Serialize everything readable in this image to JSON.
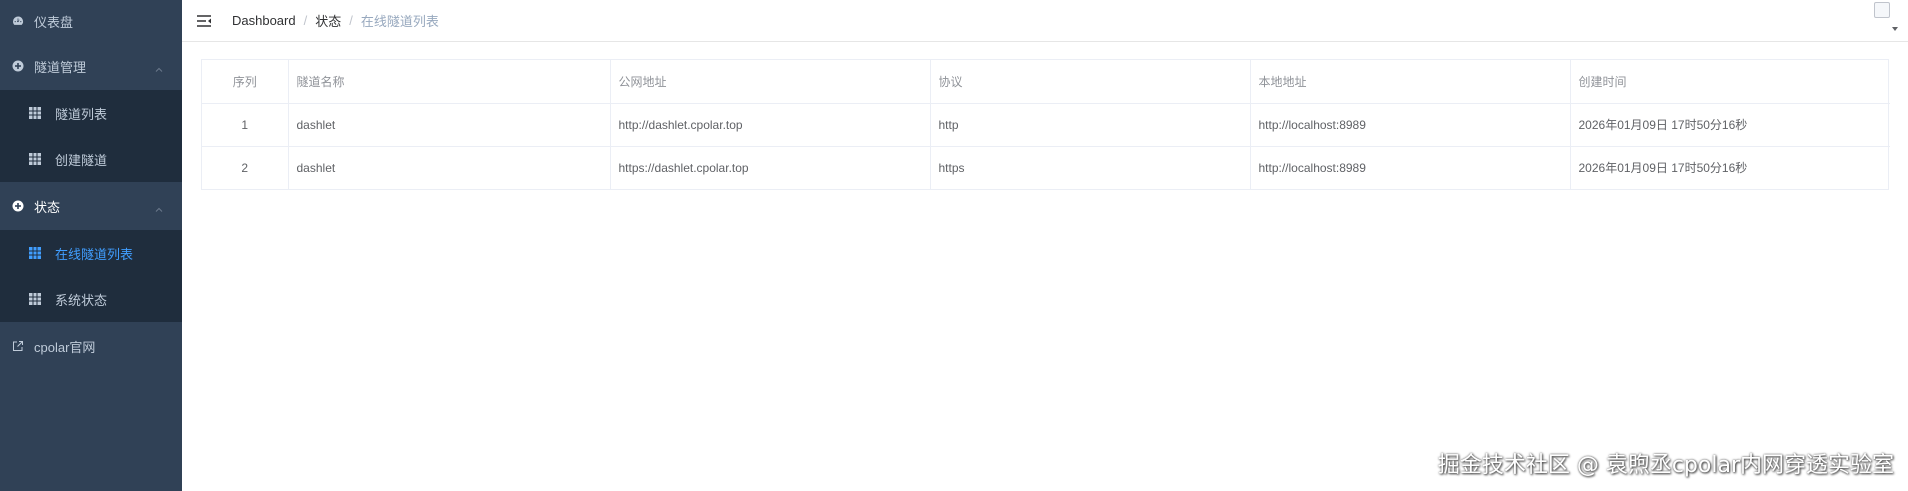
{
  "sidebar": {
    "dashboard": "仪表盘",
    "tunnel_manage": "隧道管理",
    "tunnel_list": "隧道列表",
    "create_tunnel": "创建隧道",
    "status": "状态",
    "online_tunnels": "在线隧道列表",
    "system_status": "系统状态",
    "cpolar_site": "cpolar官网"
  },
  "breadcrumb": {
    "home": "Dashboard",
    "level2": "状态",
    "current": "在线隧道列表",
    "separator": "/"
  },
  "table": {
    "headers": [
      "序列",
      "隧道名称",
      "公网地址",
      "协议",
      "本地地址",
      "创建时间"
    ],
    "rows": [
      [
        "1",
        "dashlet",
        "http://dashlet.cpolar.top",
        "http",
        "http://localhost:8989",
        "2026年01月09日 17时50分16秒"
      ],
      [
        "2",
        "dashlet",
        "https://dashlet.cpolar.top",
        "https",
        "http://localhost:8989",
        "2026年01月09日 17时50分16秒"
      ]
    ]
  },
  "watermark": "掘金技术社区 @ 袁煦丞cpolar内网穿透实验室",
  "colors": {
    "sidebar_bg": "#304156",
    "submenu_bg": "#1f2d3d",
    "sidebar_text": "#bfcbd9",
    "active": "#409eff"
  }
}
